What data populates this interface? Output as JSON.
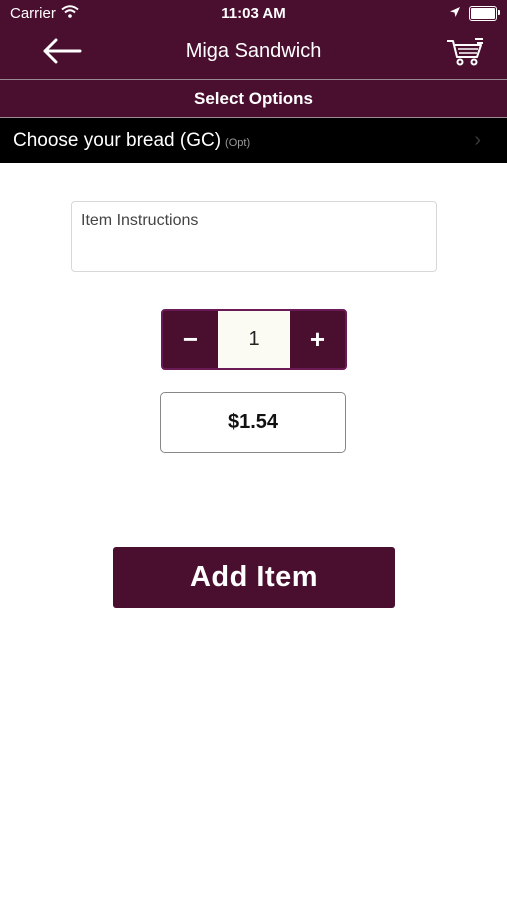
{
  "status_bar": {
    "carrier": "Carrier",
    "time": "11:03 AM"
  },
  "nav": {
    "title": "Miga Sandwich",
    "back_icon": "arrow-left-icon",
    "cart_icon": "shopping-cart-icon"
  },
  "options_bar": {
    "title": "Select Options"
  },
  "option_group": {
    "label": "Choose your bread (GC)",
    "badge": "(Opt)",
    "chevron": "›"
  },
  "instructions": {
    "placeholder": "Item Instructions"
  },
  "quantity": {
    "decrement_label": "−",
    "value": "1",
    "increment_label": "+"
  },
  "price": "$1.54",
  "add_button": {
    "label": "Add Item"
  },
  "colors": {
    "brand": "#4a0f2f",
    "option_row": "#000000"
  }
}
